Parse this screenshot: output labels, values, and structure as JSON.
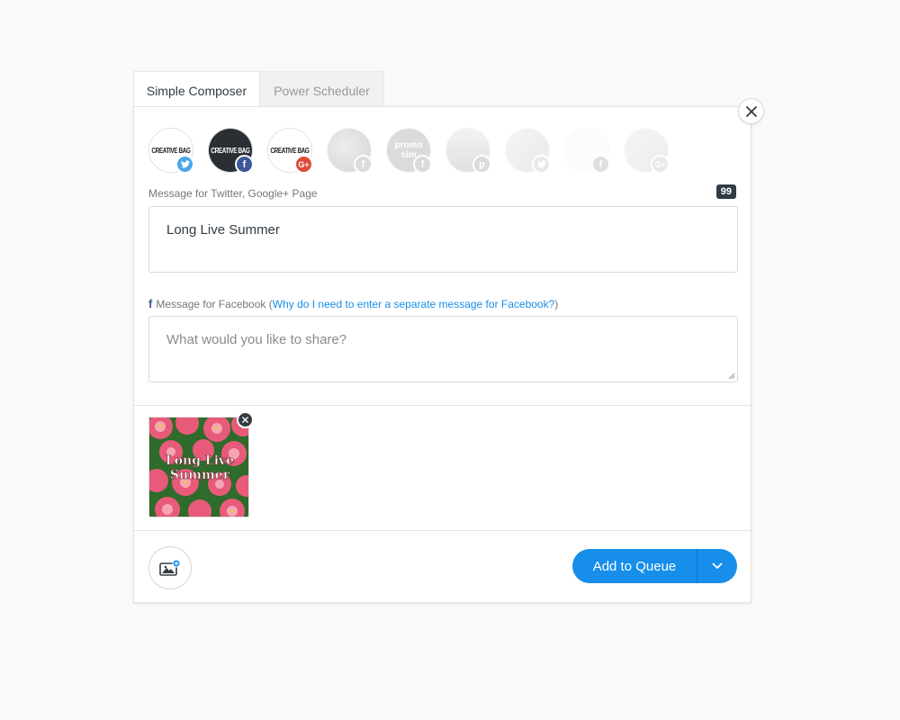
{
  "tabs": [
    {
      "label": "Simple Composer",
      "active": true
    },
    {
      "label": "Power Scheduler",
      "active": false
    }
  ],
  "profiles": [
    {
      "avatar_text": "CREATIVE BAG",
      "network": "twitter",
      "network_icon": "twitter-icon",
      "badge_color": "#4aa8e6",
      "selected": true
    },
    {
      "avatar_text": "CREATIVE BAG",
      "network": "facebook",
      "network_icon": "facebook-icon",
      "badge_color": "#3b5998",
      "selected": true
    },
    {
      "avatar_text": "CREATIVE BAG",
      "network": "google-plus",
      "network_icon": "google-plus-icon",
      "badge_color": "#dd4b39",
      "selected": true
    },
    {
      "avatar_text": "",
      "network": "facebook",
      "network_icon": "facebook-icon",
      "badge_color": "#aaaaaa",
      "selected": false
    },
    {
      "avatar_text": "promo sim",
      "network": "facebook",
      "network_icon": "facebook-icon",
      "badge_color": "#aaaaaa",
      "selected": false
    },
    {
      "avatar_text": "",
      "network": "pinterest",
      "network_icon": "pinterest-icon",
      "badge_color": "#aaaaaa",
      "selected": false
    },
    {
      "avatar_text": "",
      "network": "twitter",
      "network_icon": "twitter-icon",
      "badge_color": "#aaaaaa",
      "selected": false
    },
    {
      "avatar_text": "",
      "network": "facebook",
      "network_icon": "facebook-icon",
      "badge_color": "#aaaaaa",
      "selected": false
    },
    {
      "avatar_text": "",
      "network": "google-plus",
      "network_icon": "google-plus-icon",
      "badge_color": "#aaaaaa",
      "selected": false
    }
  ],
  "twitter_message": {
    "label": "Message for Twitter, Google+ Page",
    "char_count": "99",
    "value": "Long Live Summer"
  },
  "facebook_message": {
    "label": "Message for Facebook",
    "help_link": "Why do I need to enter a separate message for Facebook?",
    "placeholder": "What would you like to share?",
    "value": ""
  },
  "media": {
    "caption_line1": "Long Live",
    "caption_line2": "Summer"
  },
  "actions": {
    "add_to_queue": "Add to Queue"
  },
  "colors": {
    "accent": "#168eea",
    "dark": "#323b43"
  }
}
